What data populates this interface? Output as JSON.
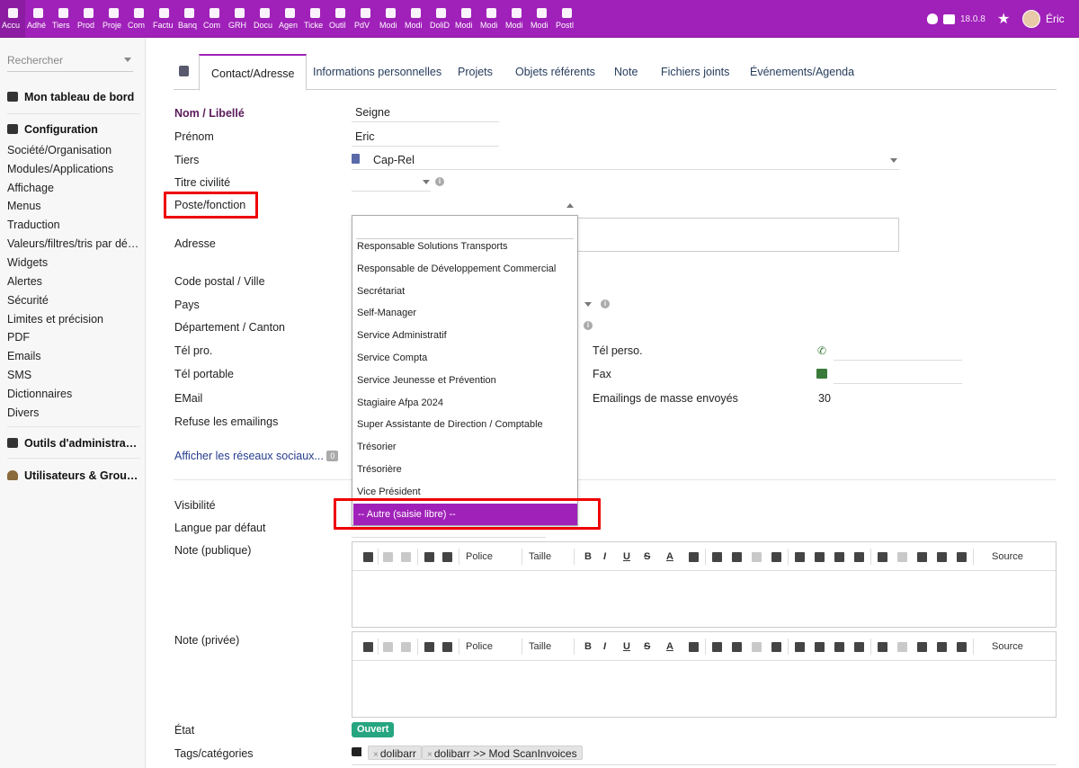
{
  "topbar": {
    "menus": [
      "Accu",
      "Adhé",
      "Tiers",
      "Prod",
      "Proje",
      "Com",
      "Factu",
      "Banq",
      "Com",
      "GRH",
      "Docu",
      "Agen",
      "Ticke",
      "Outil",
      "PdV",
      "Modi",
      "Modi",
      "DoliD",
      "Modi",
      "Modi",
      "Modi",
      "Modi",
      "Postl"
    ],
    "version": "18.0.8",
    "user": "Éric",
    "accent": "#a021b9"
  },
  "sidebar": {
    "search_placeholder": "Rechercher",
    "dashboard": "Mon tableau de bord",
    "config_title": "Configuration",
    "config_items": [
      "Société/Organisation",
      "Modules/Applications",
      "Affichage",
      "Menus",
      "Traduction",
      "Valeurs/filtres/tris par déf…",
      "Widgets",
      "Alertes",
      "Sécurité",
      "Limites et précision",
      "PDF",
      "Emails",
      "SMS",
      "Dictionnaires",
      "Divers"
    ],
    "admin_tools": "Outils d'administrati…",
    "users_groups": "Utilisateurs & Group…"
  },
  "tabs": [
    "Contact/Adresse",
    "Informations personnelles",
    "Projets",
    "Objets référents",
    "Note",
    "Fichiers joints",
    "Événements/Agenda"
  ],
  "form": {
    "nom_label": "Nom / Libellé",
    "nom_value": "Seigne",
    "prenom_label": "Prénom",
    "prenom_value": "Eric",
    "tiers_label": "Tiers",
    "tiers_value": "Cap-Rel",
    "titre_label": "Titre civilité",
    "poste_label": "Poste/fonction",
    "adresse_label": "Adresse",
    "cp_label": "Code postal / Ville",
    "pays_label": "Pays",
    "dept_label": "Département / Canton",
    "telpro_label": "Tél pro.",
    "telperso_label": "Tél perso.",
    "telport_label": "Tél portable",
    "fax_label": "Fax",
    "email_label": "EMail",
    "emailings_label": "Emailings de masse envoyés",
    "emailings_value": "30",
    "refuse_label": "Refuse les emailings",
    "social_link": "Afficher les réseaux sociaux...",
    "social_count": "0",
    "visibilite_label": "Visibilité",
    "langue_label": "Langue par défaut",
    "note_pub_label": "Note (publique)",
    "note_priv_label": "Note (privée)",
    "etat_label": "État",
    "etat_value": "Ouvert",
    "tags_label": "Tags/catégories",
    "tags": [
      "dolibarr",
      "dolibarr >> Mod ScanInvoices"
    ]
  },
  "dropdown_options": [
    "Responsable Solutions Transports",
    "Responsable de Développement Commercial",
    "Secrétariat",
    "Self-Manager",
    "Service Administratif",
    "Service Compta",
    "Service Jeunesse et Prévention",
    "Stagiaire Afpa 2024",
    "Super Assistante de Direction / Comptable",
    "Trésorier",
    "Trésorière",
    "Vice Président",
    "-- Autre (saisie libre) --"
  ],
  "editor": {
    "police": "Police",
    "taille": "Taille",
    "source": "Source",
    "bold": "B",
    "italic": "I",
    "underline": "U",
    "strike": "S",
    "fontcolor": "A"
  }
}
